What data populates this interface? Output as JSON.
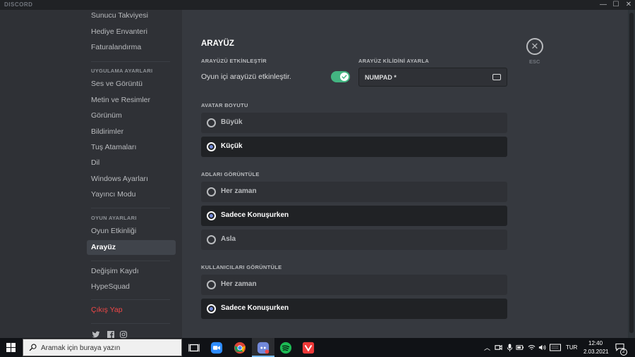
{
  "titlebar": {
    "brand": "DISCORD",
    "minimize": "—",
    "maximize": "☐",
    "close": "✕"
  },
  "sidebar": {
    "top_items": [
      "Sunucu Takviyesi",
      "Hediye Envanteri",
      "Faturalandırma"
    ],
    "app_header": "UYGULAMA AYARLARI",
    "app_items": [
      "Ses ve Görüntü",
      "Metin ve Resimler",
      "Görünüm",
      "Bildirimler",
      "Tuş Atamaları",
      "Dil",
      "Windows Ayarları",
      "Yayıncı Modu"
    ],
    "game_header": "OYUN AYARLARI",
    "game_items": [
      "Oyun Etkinliği",
      "Arayüz"
    ],
    "misc_items": [
      "Değişim Kaydı",
      "HypeSquad"
    ],
    "logout": "Çıkış Yap",
    "social": [
      "twitter-icon",
      "facebook-icon",
      "instagram-icon"
    ]
  },
  "content": {
    "title": "ARAYÜZ",
    "enable_label": "ARAYÜZÜ ETKİNLEŞTİR",
    "enable_toggle_text": "Oyun içi arayüzü etkinleştir.",
    "enable_on": true,
    "lock_label": "ARAYÜZ KİLİDİNİ AYARLA",
    "lock_value": "NUMPAD *",
    "esc": "ESC",
    "avatar_label": "AVATAR BOYUTU",
    "avatar_options": [
      "Büyük",
      "Küçük"
    ],
    "avatar_selected": 1,
    "names_label": "ADLARI GÖRÜNTÜLE",
    "names_options": [
      "Her zaman",
      "Sadece Konuşurken",
      "Asla"
    ],
    "names_selected": 1,
    "users_label": "KULLANICILARI GÖRÜNTÜLE",
    "users_options": [
      "Her zaman",
      "Sadece Konuşurken"
    ],
    "users_selected": 1
  },
  "taskbar": {
    "search_placeholder": "Aramak için buraya yazın",
    "lang": "TUR",
    "time": "12:40",
    "date": "2.03.2021",
    "notif_count": "2",
    "colors": {
      "accent": "#7289da",
      "toggle_on": "#43b581",
      "danger": "#f04747"
    }
  }
}
